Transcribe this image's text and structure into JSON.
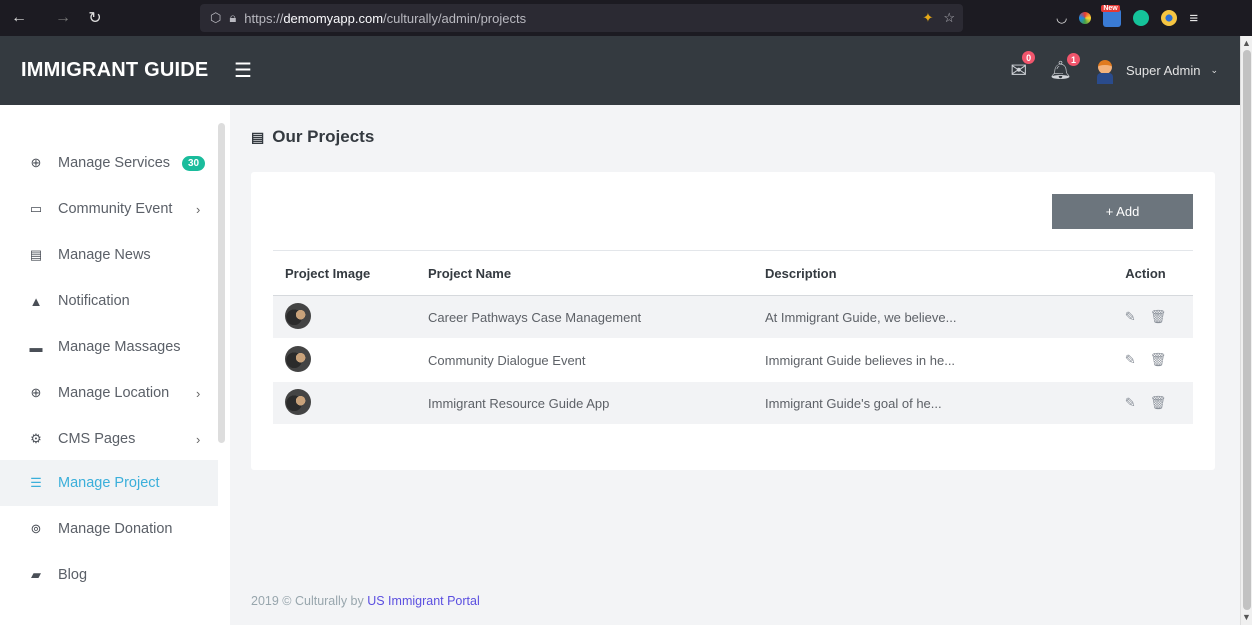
{
  "browser": {
    "url_prefix": "https://",
    "url_domain": "demomyapp.com",
    "url_path": "/culturally/admin/projects",
    "new_badge": "New"
  },
  "header": {
    "brand": "IMMIGRANT GUIDE",
    "messages_count": "0",
    "notifications_count": "1",
    "user_name": "Super Admin"
  },
  "sidebar": {
    "items": [
      {
        "label": "Manage Services",
        "icon": "globe-icon",
        "badge": "30"
      },
      {
        "label": "Community Event",
        "icon": "calendar-icon"
      },
      {
        "label": "Manage News",
        "icon": "newspaper-icon"
      },
      {
        "label": "Notification",
        "icon": "bell-icon"
      },
      {
        "label": "Manage Massages",
        "icon": "message-icon"
      },
      {
        "label": "Manage Location",
        "icon": "globe-icon"
      },
      {
        "label": "CMS Pages",
        "icon": "gear-icon"
      },
      {
        "label": "Manage Project",
        "icon": "list-icon",
        "active": true
      },
      {
        "label": "Manage Donation",
        "icon": "donation-icon"
      },
      {
        "label": "Blog",
        "icon": "blog-icon"
      }
    ]
  },
  "main": {
    "title": "Our Projects",
    "add_label": "+ Add",
    "columns": [
      "Project Image",
      "Project Name",
      "Description",
      "Action"
    ],
    "rows": [
      {
        "name": "Career Pathways Case Management",
        "description": "At Immigrant Guide, we believe..."
      },
      {
        "name": "Community Dialogue Event",
        "description": "Immigrant Guide believes in he..."
      },
      {
        "name": "Immigrant Resource Guide App",
        "description": "Immigrant Guide's goal of he..."
      }
    ]
  },
  "footer": {
    "text": "2019 © Culturally by ",
    "link": "US Immigrant Portal"
  }
}
